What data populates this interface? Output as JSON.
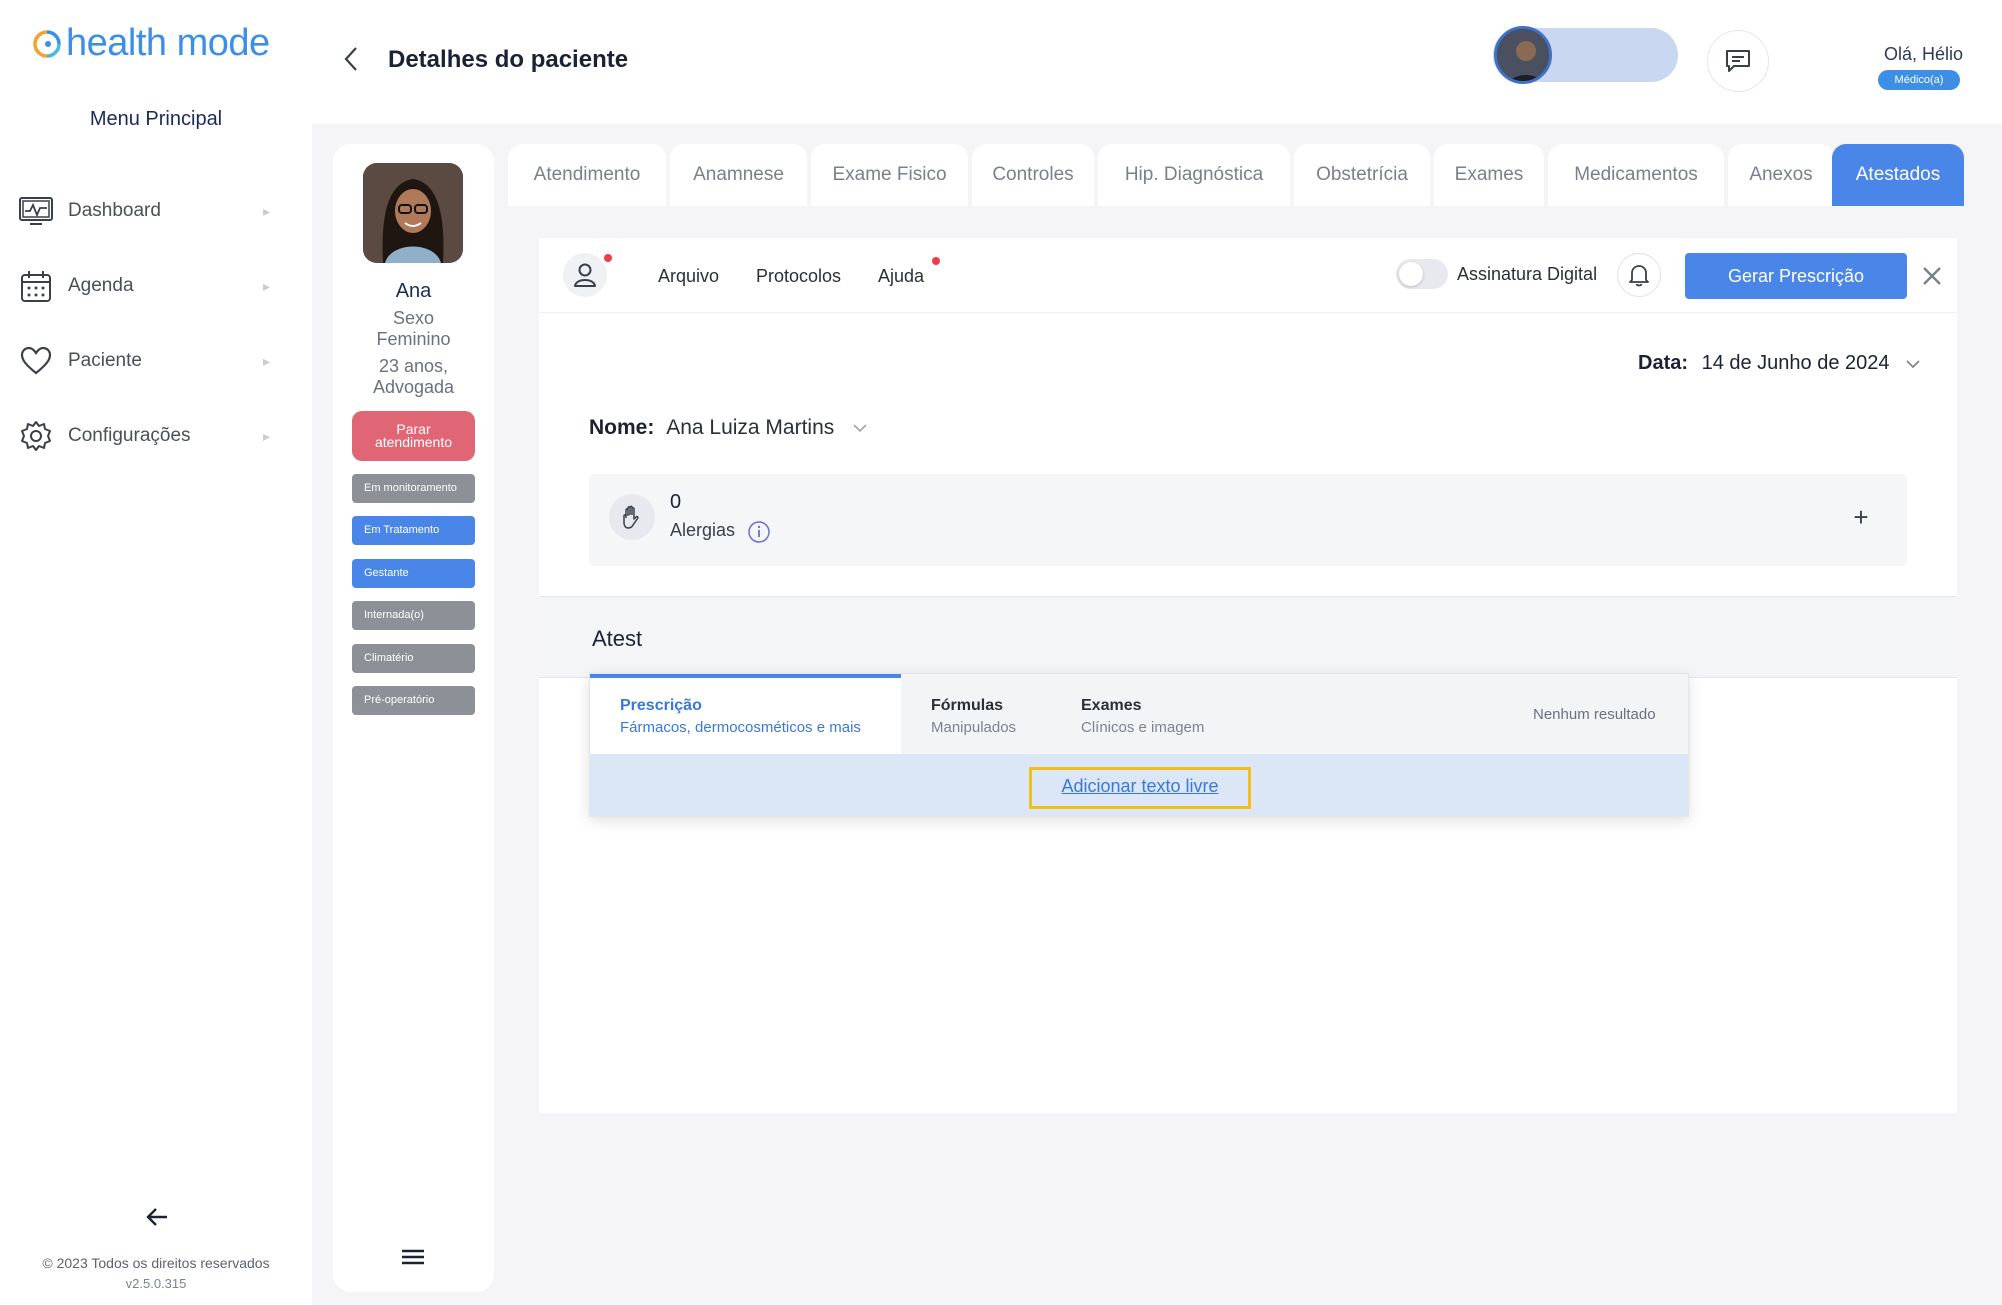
{
  "brand": {
    "name": "health mode",
    "accent": "#3d8fe6"
  },
  "sidebar": {
    "menu_title": "Menu Principal",
    "items": [
      {
        "label": "Dashboard",
        "icon": "monitor-chart-icon"
      },
      {
        "label": "Agenda",
        "icon": "calendar-icon"
      },
      {
        "label": "Paciente",
        "icon": "heart-icon"
      },
      {
        "label": "Configurações",
        "icon": "gear-icon"
      }
    ],
    "copyright": "© 2023 Todos os direitos reservados",
    "version": "v2.5.0.315"
  },
  "header": {
    "title": "Detalhes do paciente",
    "greeting": "Olá, Hélio",
    "role": "Médico(a)"
  },
  "patient": {
    "name": "Ana",
    "sex_line1": "Sexo",
    "sex_line2": "Feminino",
    "age_line": "23 anos,",
    "job_line": "Advogada",
    "stop_line1": "Parar",
    "stop_line2": "atendimento",
    "tags": [
      {
        "label": "Em monitoramento",
        "color": "gray"
      },
      {
        "label": "Em Tratamento",
        "color": "blue"
      },
      {
        "label": "Gestante",
        "color": "blue"
      },
      {
        "label": "Internada(o)",
        "color": "gray"
      },
      {
        "label": "Climatério",
        "color": "gray"
      },
      {
        "label": "Pré-operatório",
        "color": "gray"
      }
    ]
  },
  "tabs": [
    {
      "label": "Atendimento"
    },
    {
      "label": "Anamnese"
    },
    {
      "label": "Exame Fisico"
    },
    {
      "label": "Controles"
    },
    {
      "label": "Hip. Diagnóstica"
    },
    {
      "label": "Obstetrícia"
    },
    {
      "label": "Exames"
    },
    {
      "label": "Medicamentos"
    },
    {
      "label": "Anexos"
    },
    {
      "label": "Atestados",
      "active": true
    }
  ],
  "toolbar": {
    "arquivo": "Arquivo",
    "protocolos": "Protocolos",
    "ajuda": "Ajuda",
    "assinatura": "Assinatura Digital",
    "gerar": "Gerar Prescrição"
  },
  "form": {
    "data_label": "Data:",
    "data_value": "14 de Junho de 2024",
    "nome_label": "Nome:",
    "nome_value": "Ana Luiza Martins",
    "allergy_count": "0",
    "allergy_label": "Alergias",
    "atest_value": "Atest"
  },
  "dropdown": {
    "tabs": [
      {
        "title": "Prescrição",
        "sub": "Fármacos, dermocosméticos e mais"
      },
      {
        "title": "Fórmulas",
        "sub": "Manipulados"
      },
      {
        "title": "Exames",
        "sub": "Clínicos e imagem"
      }
    ],
    "no_result": "Nenhum resultado",
    "add_free_text": "Adicionar texto livre"
  }
}
